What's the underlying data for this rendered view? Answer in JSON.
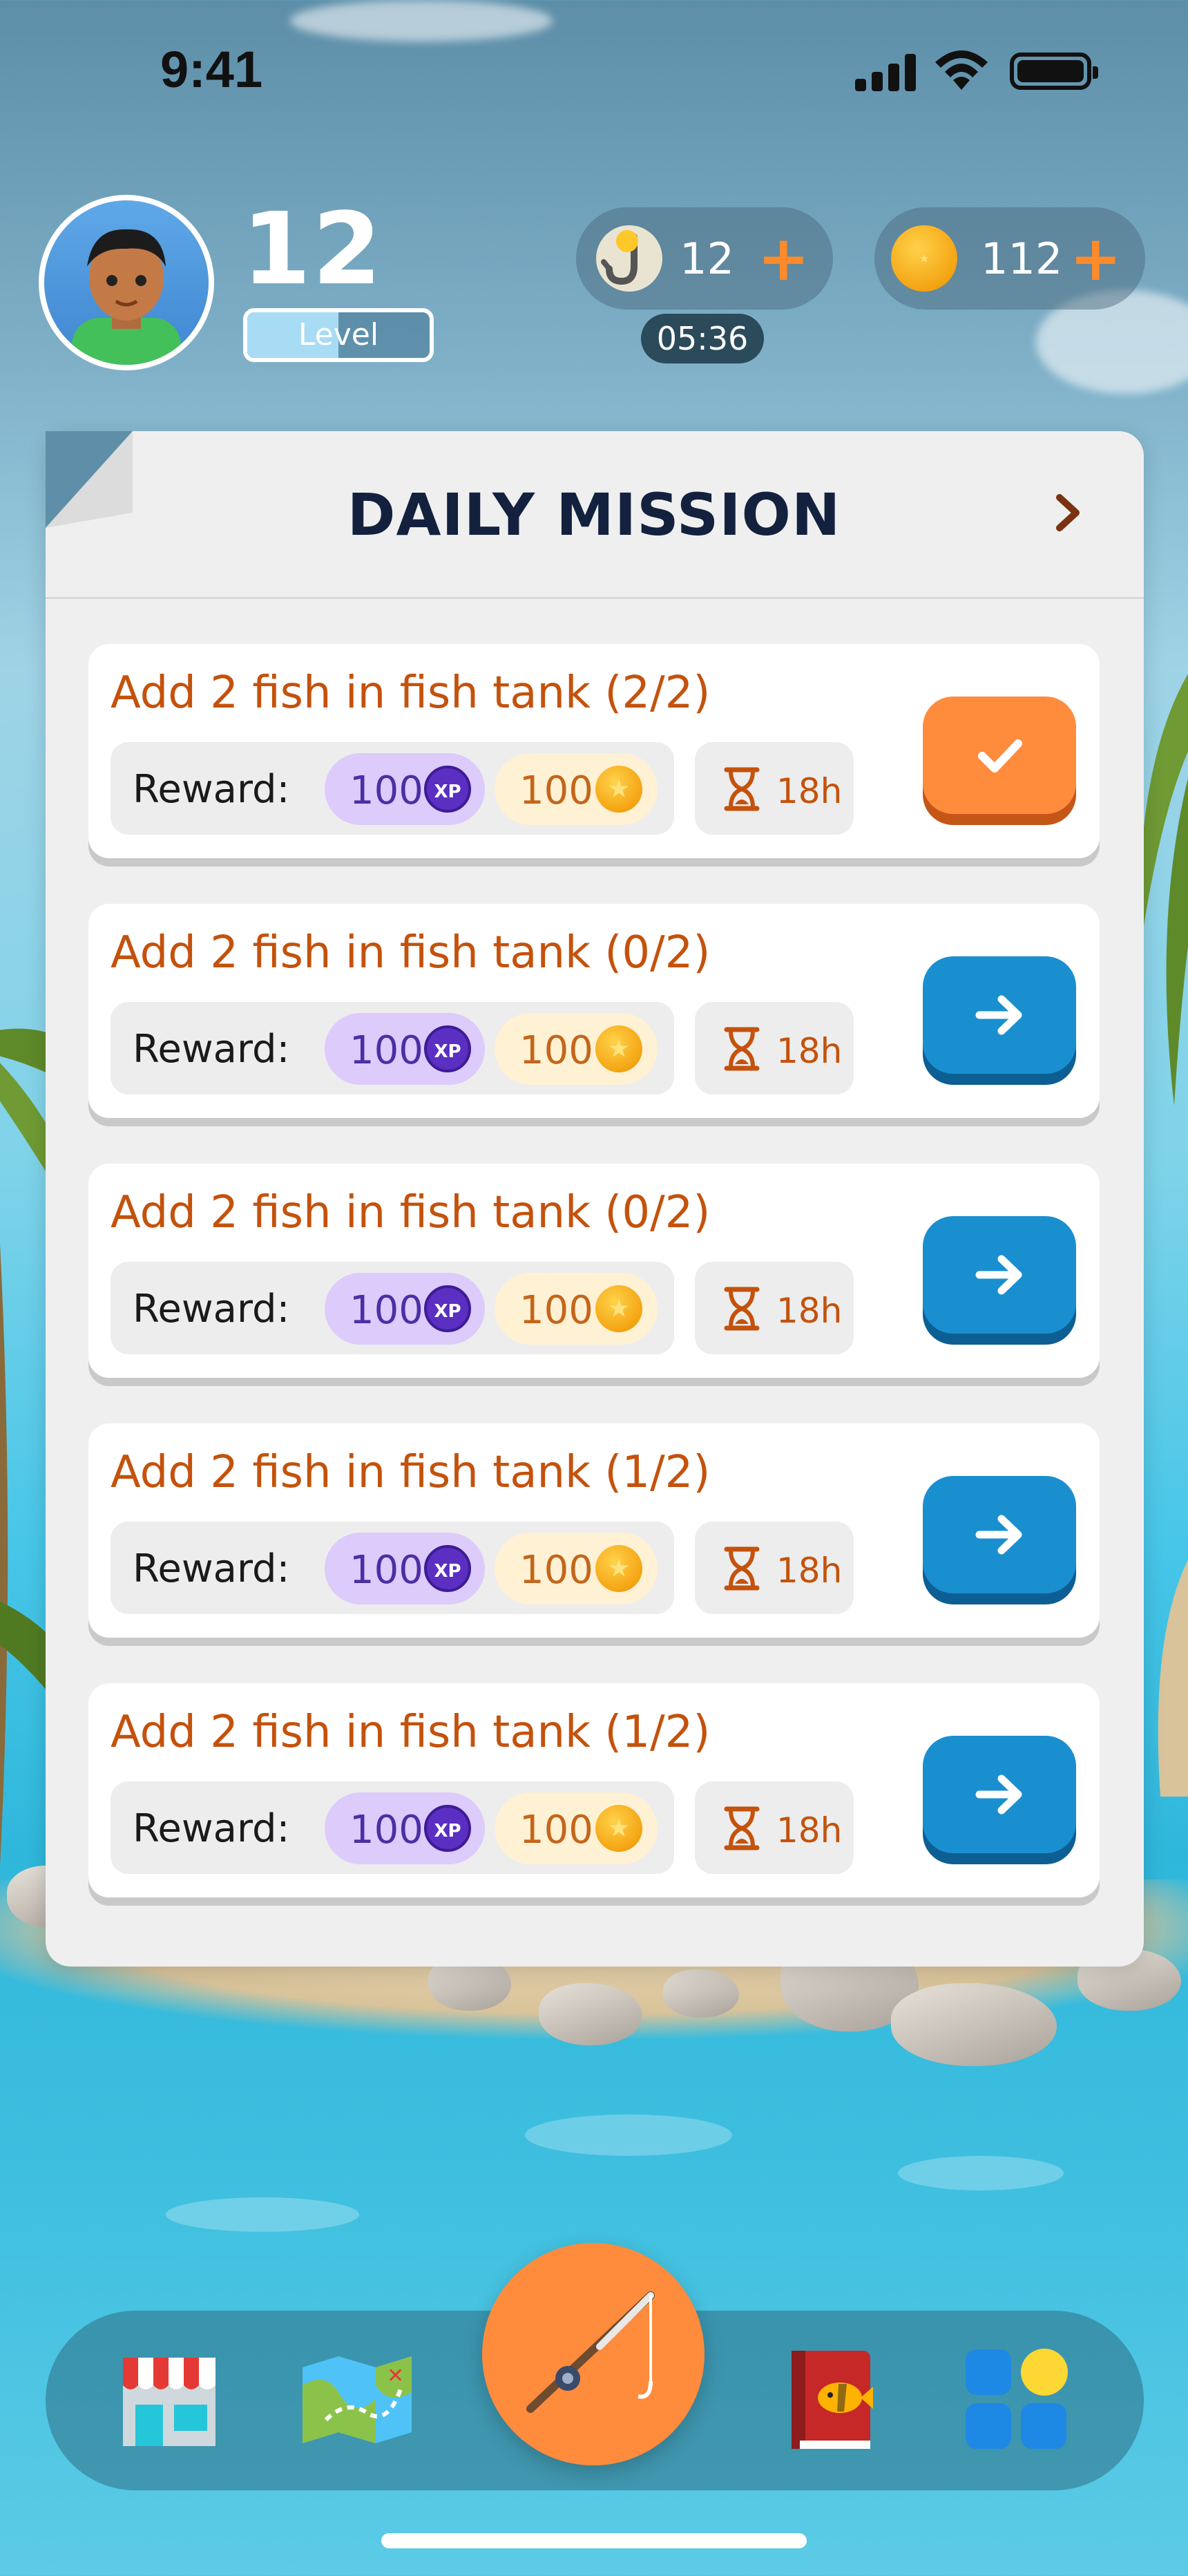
{
  "status_bar": {
    "time": "9:41"
  },
  "player": {
    "level": "12",
    "level_label": "Level",
    "level_progress": 0.5
  },
  "resources": {
    "hooks": {
      "count": "12",
      "plus": "+",
      "timer": "05:36"
    },
    "coins": {
      "count": "112",
      "plus": "+"
    }
  },
  "panel": {
    "title": "DAILY MISSION"
  },
  "missions": [
    {
      "title": "Add 2 fish in fish tank (2/2)",
      "reward_label": "Reward:",
      "xp": "100",
      "xp_badge": "XP",
      "coins": "100",
      "time": "18h",
      "status": "completed"
    },
    {
      "title": "Add 2 fish in fish tank (0/2)",
      "reward_label": "Reward:",
      "xp": "100",
      "xp_badge": "XP",
      "coins": "100",
      "time": "18h",
      "status": "go"
    },
    {
      "title": "Add 2 fish in fish tank (0/2)",
      "reward_label": "Reward:",
      "xp": "100",
      "xp_badge": "XP",
      "coins": "100",
      "time": "18h",
      "status": "go"
    },
    {
      "title": "Add 2 fish in fish tank (1/2)",
      "reward_label": "Reward:",
      "xp": "100",
      "xp_badge": "XP",
      "coins": "100",
      "time": "18h",
      "status": "go"
    },
    {
      "title": "Add 2 fish in fish tank (1/2)",
      "reward_label": "Reward:",
      "xp": "100",
      "xp_badge": "XP",
      "coins": "100",
      "time": "18h",
      "status": "go"
    }
  ],
  "nav": [
    {
      "icon": "shop-icon"
    },
    {
      "icon": "map-icon"
    },
    {
      "icon": "fishing-rod-icon"
    },
    {
      "icon": "fish-book-icon"
    },
    {
      "icon": "menu-grid-icon"
    }
  ],
  "colors": {
    "accent_orange": "#ff8b3d",
    "go_blue": "#1a8fd0",
    "mission_text": "#c4520c",
    "title_navy": "#13213f"
  }
}
